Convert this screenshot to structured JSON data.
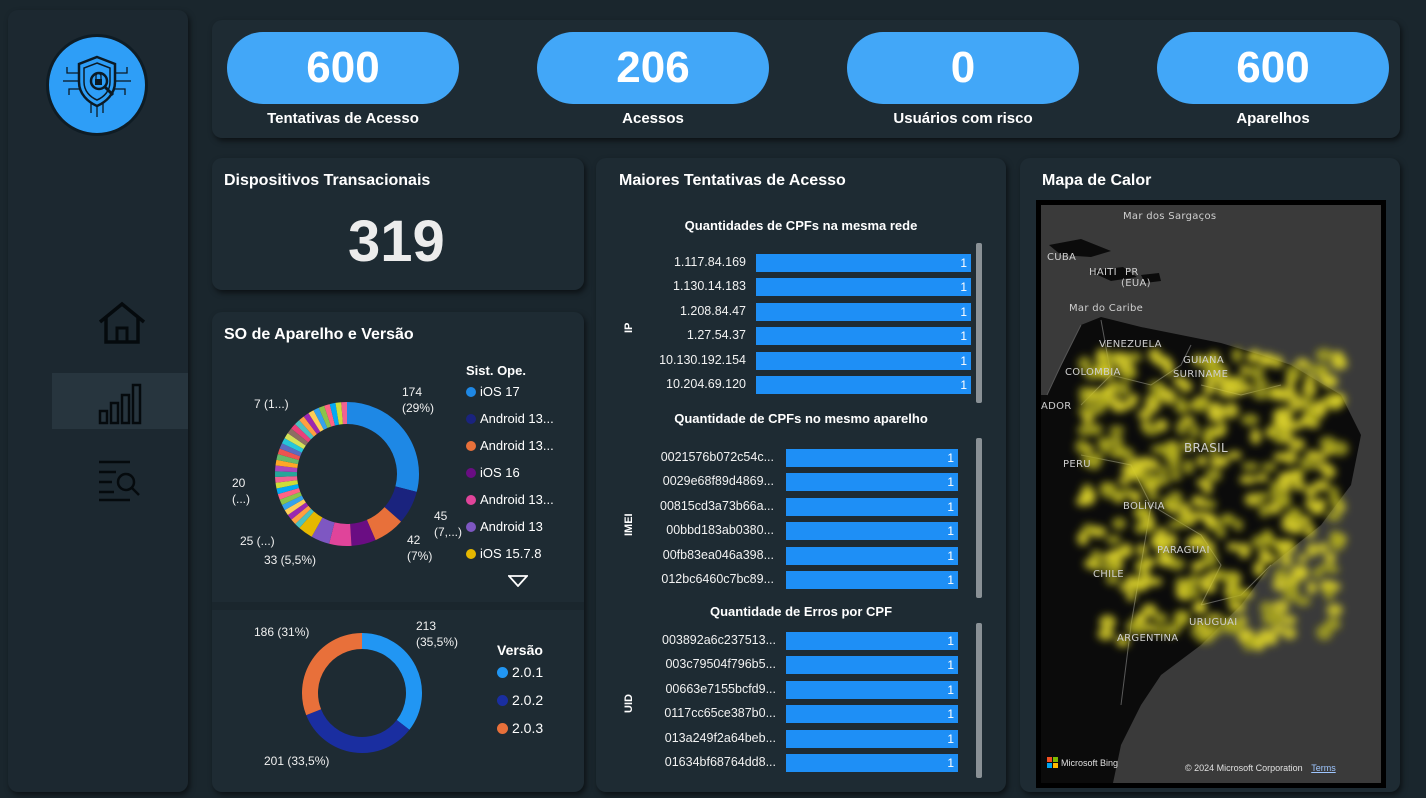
{
  "kpis": [
    {
      "value": "600",
      "label": "Tentativas de Acesso"
    },
    {
      "value": "206",
      "label": "Acessos"
    },
    {
      "value": "0",
      "label": "Usuários com risco"
    },
    {
      "value": "600",
      "label": "Aparelhos"
    }
  ],
  "dispositivos": {
    "title": "Dispositivos Transacionais",
    "value": "319"
  },
  "so": {
    "title": "SO de Aparelho e Versão",
    "legend_title": "Sist. Ope.",
    "legend": [
      {
        "label": "iOS 17",
        "color": "#1e88e5"
      },
      {
        "label": "Android 13...",
        "color": "#1a237e"
      },
      {
        "label": "Android 13...",
        "color": "#e8703a"
      },
      {
        "label": "iOS 16",
        "color": "#6a0d83"
      },
      {
        "label": "Android 13...",
        "color": "#e0449a"
      },
      {
        "label": "Android 13",
        "color": "#7e57c2"
      },
      {
        "label": "iOS 15.7.8",
        "color": "#e6b800"
      }
    ],
    "labels": {
      "top_right": "174",
      "top_right_pct": "(29%)",
      "right": "45",
      "right_pct": "(7,...)",
      "right_low": "42",
      "right_low_pct": "(7%)",
      "bottom": "33 (5,5%)",
      "left_low": "25 (...)",
      "left": "20",
      "left_pct": "(...)",
      "top_left": "7 (1...)"
    },
    "chart_data": {
      "type": "pie",
      "categories": [
        "iOS 17",
        "Android 13...",
        "Android 13...",
        "iOS 16",
        "Android 13...",
        "Android 13",
        "iOS 15.7.8"
      ],
      "values": [
        174,
        45,
        42,
        33,
        30,
        25,
        20
      ]
    }
  },
  "versao": {
    "legend_title": "Versão",
    "legend": [
      {
        "label": "2.0.1",
        "color": "#2196f3"
      },
      {
        "label": "2.0.2",
        "color": "#1a2ea0"
      },
      {
        "label": "2.0.3",
        "color": "#e8703a"
      }
    ],
    "labels": {
      "a": "213",
      "a_pct": "(35,5%)",
      "b": "201 (33,5%)",
      "c": "186 (31%)"
    },
    "chart_data": {
      "type": "pie",
      "categories": [
        "2.0.1",
        "2.0.2",
        "2.0.3"
      ],
      "values": [
        213,
        201,
        186
      ]
    }
  },
  "maiores": {
    "title": "Maiores Tentativas de Acesso",
    "rede": {
      "title": "Quantidades de CPFs na mesma rede",
      "axis": "IP",
      "rows": [
        {
          "label": "1.117.84.169",
          "value": "1"
        },
        {
          "label": "1.130.14.183",
          "value": "1"
        },
        {
          "label": "1.208.84.47",
          "value": "1"
        },
        {
          "label": "1.27.54.37",
          "value": "1"
        },
        {
          "label": "10.130.192.154",
          "value": "1"
        },
        {
          "label": "10.204.69.120",
          "value": "1"
        }
      ]
    },
    "aparelho": {
      "title": "Quantidade de CPFs no mesmo aparelho",
      "axis": "IMEI",
      "rows": [
        {
          "label": "0021576b072c54c...",
          "value": "1"
        },
        {
          "label": "0029e68f89d4869...",
          "value": "1"
        },
        {
          "label": "00815cd3a73b66a...",
          "value": "1"
        },
        {
          "label": "00bbd183ab0380...",
          "value": "1"
        },
        {
          "label": "00fb83ea046a398...",
          "value": "1"
        },
        {
          "label": "012bc6460c7bc89...",
          "value": "1"
        }
      ]
    },
    "erros": {
      "title": "Quantidade de Erros por CPF",
      "axis": "UID",
      "rows": [
        {
          "label": "003892a6c237513...",
          "value": "1"
        },
        {
          "label": "003c79504f796b5...",
          "value": "1"
        },
        {
          "label": "00663e7155bcfd9...",
          "value": "1"
        },
        {
          "label": "0117cc65ce387b0...",
          "value": "1"
        },
        {
          "label": "013a249f2a64beb...",
          "value": "1"
        },
        {
          "label": "01634bf68764dd8...",
          "value": "1"
        }
      ]
    }
  },
  "mapa": {
    "title": "Mapa de Calor",
    "places": {
      "sargacos": "Mar dos Sargaços",
      "cuba": "CUBA",
      "haiti": "HAITI",
      "pr": "PR",
      "eua": "(EUA)",
      "caribe": "Mar do Caribe",
      "venezuela": "VENEZUELA",
      "guiana": "GUIANA",
      "suriname": "SURINAME",
      "colombia": "COLOMBIA",
      "equador": "ADOR",
      "brasil": "BRASIL",
      "peru": "PERU",
      "bolivia": "BOLÍVIA",
      "paraguai": "PARAGUAI",
      "chile": "CHILE",
      "uruguai": "URUGUAI",
      "argentina": "ARGENTINA"
    },
    "bing": "Microsoft Bing",
    "copyright": "© 2024 Microsoft Corporation",
    "terms": "Terms"
  }
}
